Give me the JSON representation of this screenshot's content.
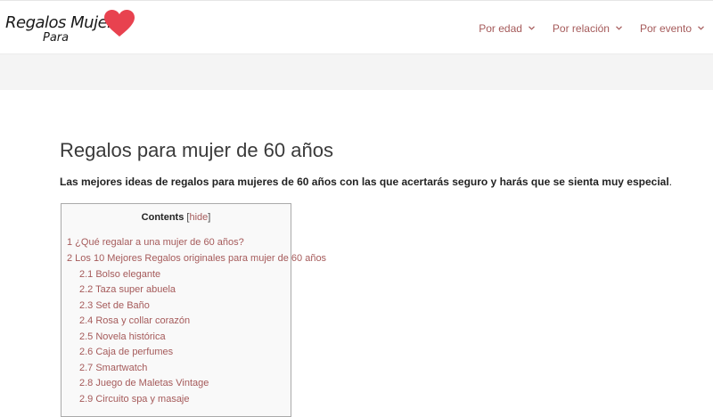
{
  "header": {
    "logo_main": "Regalos Mujer",
    "logo_sub": "Para",
    "logo_icon": "heart-icon",
    "accent": "#a55a5a",
    "heart_color": "#e8424f"
  },
  "nav": {
    "items": [
      {
        "label": "Por edad"
      },
      {
        "label": "Por relación"
      },
      {
        "label": "Por evento"
      }
    ]
  },
  "article": {
    "title": "Regalos para mujer de 60 años",
    "intro": "Las mejores ideas de regalos para mujeres de 60 años con las que acertarás seguro y harás que se sienta muy especial",
    "intro_end": "."
  },
  "toc": {
    "title": "Contents",
    "toggle_open": "[",
    "toggle_label": "hide",
    "toggle_close": "]",
    "items": [
      {
        "label": "1 ¿Qué regalar a una mujer de 60 años?"
      },
      {
        "label": "2 Los 10 Mejores Regalos originales para mujer de 60 años"
      },
      {
        "label": "2.1 Bolso elegante"
      },
      {
        "label": "2.2 Taza super abuela"
      },
      {
        "label": "2.3 Set de Baño"
      },
      {
        "label": "2.4 Rosa y collar corazón"
      },
      {
        "label": "2.5 Novela histórica"
      },
      {
        "label": "2.6 Caja de perfumes"
      },
      {
        "label": "2.7 Smartwatch"
      },
      {
        "label": "2.8 Juego de Maletas Vintage"
      },
      {
        "label": "2.9 Circuito spa y masaje"
      }
    ]
  }
}
